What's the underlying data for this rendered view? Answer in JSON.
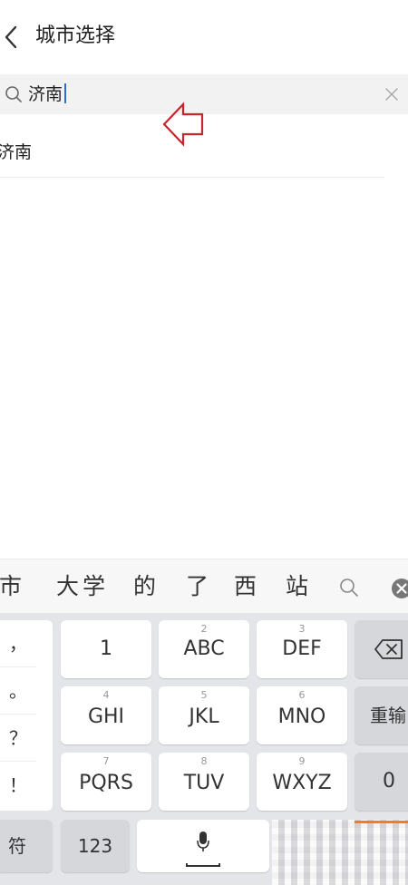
{
  "header": {
    "title": "城市选择"
  },
  "search": {
    "value": "济南"
  },
  "results": [
    {
      "label": "济南"
    }
  ],
  "candidates": {
    "items": [
      "市",
      "大学",
      "的",
      "了",
      "西",
      "站"
    ]
  },
  "keyboard": {
    "punctuation": [
      "，",
      "。",
      "？",
      "！"
    ],
    "keys": [
      {
        "num": "",
        "label": "1"
      },
      {
        "num": "2",
        "label": "ABC"
      },
      {
        "num": "3",
        "label": "DEF"
      },
      {
        "num": "4",
        "label": "GHI"
      },
      {
        "num": "5",
        "label": "JKL"
      },
      {
        "num": "6",
        "label": "MNO"
      },
      {
        "num": "7",
        "label": "PQRS"
      },
      {
        "num": "8",
        "label": "TUV"
      },
      {
        "num": "9",
        "label": "WXYZ"
      }
    ],
    "reinput_label": "重输",
    "zero_label": "0",
    "symbol_label": "符",
    "numeric_label": "123"
  },
  "icons": {
    "back": "chevron-left-icon",
    "search": "search-icon",
    "clear": "close-icon",
    "backspace": "backspace-icon",
    "microphone": "microphone-icon"
  },
  "colors": {
    "caret": "#2a6ed6",
    "annotation_arrow": "#c8252b",
    "keyboard_background": "#e4e5e8",
    "accent_orange": "#f47a24"
  }
}
